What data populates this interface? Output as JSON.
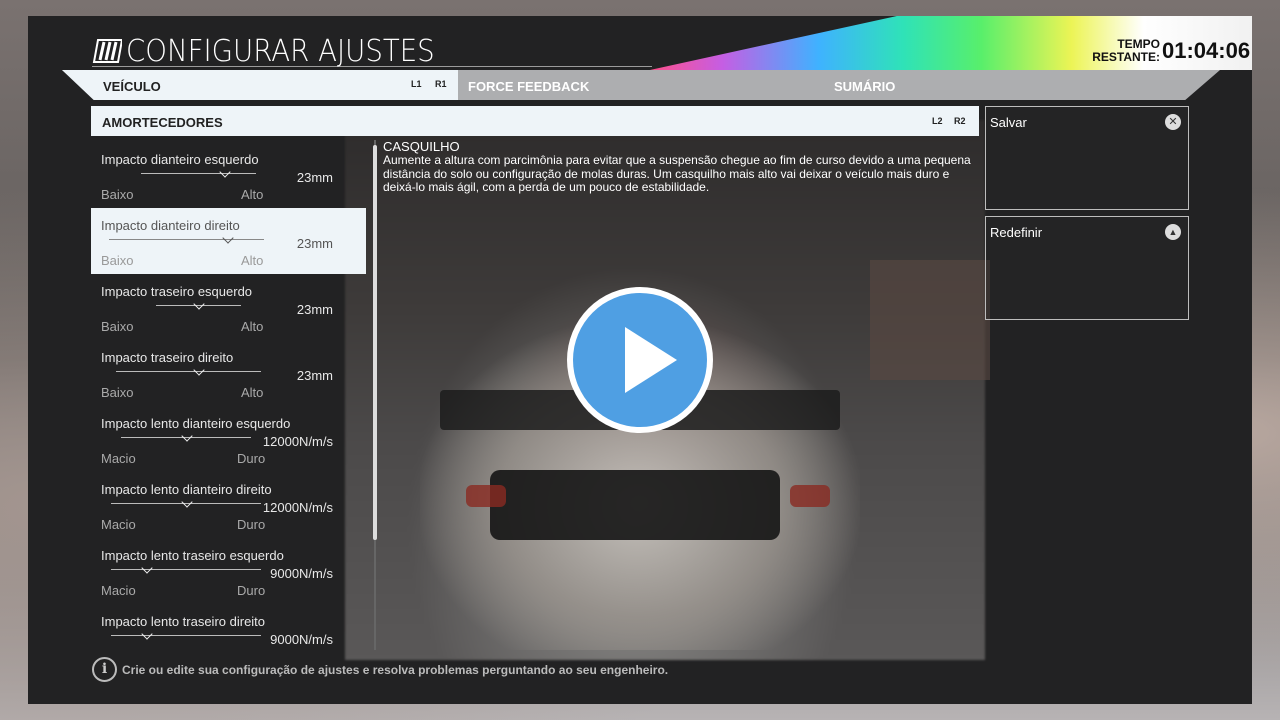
{
  "header": {
    "title": "CONFIGURAR AJUSTES",
    "time_label_1": "TEMPO",
    "time_label_2": "RESTANTE:",
    "time_value": "01:04:06"
  },
  "tabs": {
    "vehicle": "VEÍCULO",
    "l1": "L1",
    "r1": "R1",
    "force_feedback": "FORCE FEEDBACK",
    "summary": "SUMÁRIO"
  },
  "section": {
    "title": "AMORTECEDORES",
    "l2": "L2",
    "r2": "R2"
  },
  "settings": [
    {
      "name": "Impacto dianteiro esquerdo",
      "value": "23mm",
      "min": "Baixo",
      "max": "Alto",
      "position": 0.7
    },
    {
      "name": "Impacto dianteiro direito",
      "value": "23mm",
      "min": "Baixo",
      "max": "Alto",
      "position": 0.78
    },
    {
      "name": "Impacto traseiro esquerdo",
      "value": "23mm",
      "min": "Baixo",
      "max": "Alto",
      "position": 0.55
    },
    {
      "name": "Impacto traseiro direito",
      "value": "23mm",
      "min": "Baixo",
      "max": "Alto",
      "position": 0.55
    },
    {
      "name": "Impacto lento dianteiro esquerdo",
      "value": "12000N/m/s",
      "min": "Macio",
      "max": "Duro",
      "position": 0.45
    },
    {
      "name": "Impacto lento dianteiro direito",
      "value": "12000N/m/s",
      "min": "Macio",
      "max": "Duro",
      "position": 0.45
    },
    {
      "name": "Impacto lento traseiro esquerdo",
      "value": "9000N/m/s",
      "min": "Macio",
      "max": "Duro",
      "position": 0.25
    },
    {
      "name": "Impacto lento traseiro direito",
      "value": "9000N/m/s",
      "min": "",
      "max": "",
      "position": 0.25
    }
  ],
  "description": {
    "title": "CASQUILHO",
    "text": "Aumente a altura com parcimônia para evitar que a suspensão chegue ao fim de curso devido a uma pequena distância do solo ou configuração de molas duras. Um casquilho mais alto vai deixar o veículo mais duro e deixá-lo mais ágil, com a perda de um pouco de estabilidade."
  },
  "actions": {
    "save": "Salvar",
    "save_icon": "✕",
    "reset": "Redefinir",
    "reset_icon": "▲"
  },
  "footer": {
    "info_icon": "i",
    "text": "Crie ou edite sua configuração de ajustes e resolva problemas perguntando ao seu engenheiro."
  },
  "colors": {
    "highlight": "#eef4f8",
    "panel": "#222223",
    "play_button": "#4f9fe3"
  }
}
